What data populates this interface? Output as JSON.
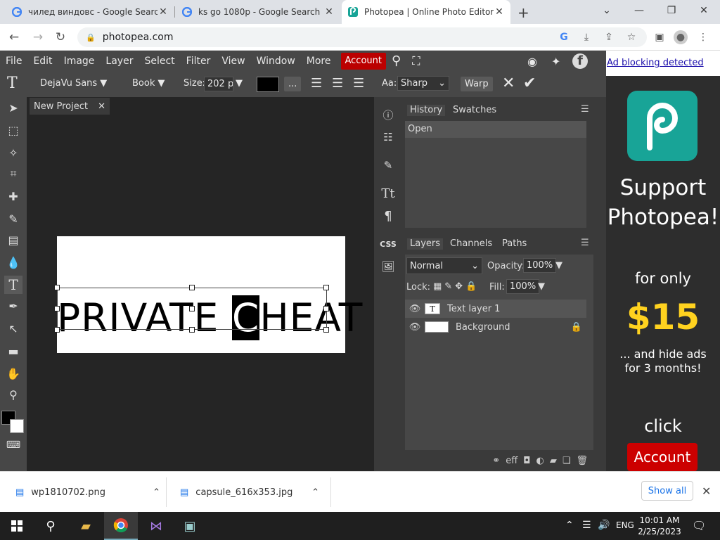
{
  "tabs": [
    {
      "title": "чилед виндовс - Google Search",
      "icon": "google-icon"
    },
    {
      "title": "ks go 1080p - Google Search",
      "icon": "google-icon"
    },
    {
      "title": "Photopea | Online Photo Editor",
      "icon": "photopea-icon"
    }
  ],
  "address": {
    "url": "photopea.com"
  },
  "menu": [
    "File",
    "Edit",
    "Image",
    "Layer",
    "Select",
    "Filter",
    "View",
    "Window",
    "More"
  ],
  "account_label": "Account",
  "options": {
    "font": "DejaVu Sans",
    "weight": "Book",
    "size_label": "Size:",
    "size_value": "202 p",
    "more": "...",
    "aa_label": "Aa:",
    "aa_value": "Sharp",
    "warp": "Warp"
  },
  "document": {
    "tab": "New Project"
  },
  "canvas": {
    "text_before": "PRIVATE ",
    "text_selected": "C",
    "text_after": "HEAT"
  },
  "history": {
    "tabs": [
      "History",
      "Swatches"
    ],
    "items": [
      "Open"
    ]
  },
  "layers": {
    "tabs": [
      "Layers",
      "Channels",
      "Paths"
    ],
    "blend": "Normal",
    "opacity_label": "Opacity:",
    "opacity": "100%",
    "lock_label": "Lock:",
    "fill_label": "Fill:",
    "fill": "100%",
    "items": [
      "Text layer 1",
      "Background"
    ]
  },
  "ad": {
    "blocking": "Ad blocking detected",
    "support": "Support Photopea!",
    "for_only": "for only",
    "price": "$15",
    "hide": "... and hide ads for 3 months!",
    "click": "click",
    "account": "Account",
    "price_color": "#ffd21f"
  },
  "downloads": [
    {
      "name": "wp1810702.png"
    },
    {
      "name": "capsule_616x353.jpg"
    }
  ],
  "show_all": "Show all",
  "taskbar": {
    "time": "10:01 AM",
    "date": "2/25/2023",
    "lang": "ENG"
  },
  "colors": {
    "accent": "#b00000",
    "panel": "#474747",
    "workspace": "#252525"
  }
}
